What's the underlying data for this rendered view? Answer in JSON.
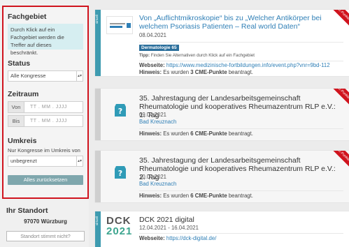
{
  "sidebar": {
    "fachgebiet": {
      "title": "Fachgebiet",
      "hint": "Durch Klick auf ein Fachgebiet werden die Treffer auf dieses beschränkt."
    },
    "status": {
      "title": "Status",
      "selected": "Alle Kongresse"
    },
    "zeitraum": {
      "title": "Zeitraum",
      "von_label": "Von",
      "bis_label": "Bis",
      "date_placeholder": "TT . MM . JJJJ"
    },
    "umkreis": {
      "title": "Umkreis",
      "desc": "Nur Kongresse im Umkreis von",
      "selected": "unbegrenzt"
    },
    "reset_label": "Alles zurücksetzen",
    "standort": {
      "title": "Ihr Standort",
      "value": "97070 Würzburg",
      "button": "Standort stimmt nicht?"
    }
  },
  "cards": [
    {
      "flag": "virtuell",
      "title": "Von „Auflichtmikroskopie“ bis zu „Welcher Antikörper bei welchem Psoriasis Patienten – Real world Daten“",
      "date": "08.04.2021",
      "badge": "Dermatologie 65",
      "tipp_label": "Tipp:",
      "tipp_text": "Finden Sie Alternativen durch Klick auf ein Fachgebiet",
      "link_label": "Webseite:",
      "link_url": "https://www.medizinische-fortbildungen.info/event.php?vnr=9bd-112",
      "note_label": "Hinweis:",
      "note_pre": "Es wurden",
      "note_points": "3 CME-Punkte",
      "note_post": "beantragt.",
      "corner": "CME-Punkte"
    },
    {
      "title": "35. Jahrestagung der Landesarbeitsgemeinschaft Rheumatologie und kooperatives Rheumazentrum RLP e.V.: 1. Tag",
      "date": "09.04.2021",
      "location": "Bad Kreuznach",
      "note_label": "Hinweis:",
      "note_pre": "Es wurden",
      "note_points": "6 CME-Punkte",
      "note_post": "beantragt.",
      "corner": "CME-Punkte"
    },
    {
      "title": "35. Jahrestagung der Landesarbeitsgemeinschaft Rheumatologie und kooperatives Rheumazentrum RLP e.V.: 2. Tag",
      "date": "10.04.2021",
      "location": "Bad Kreuznach",
      "note_label": "Hinweis:",
      "note_pre": "Es wurden",
      "note_points": "6 CME-Punkte",
      "note_post": "beantragt.",
      "corner": "CME-Punkte"
    },
    {
      "flag": "virtuell",
      "logo_top": "DCK",
      "logo_bottom": "2021",
      "title": "DCK 2021 digital",
      "date": "12.04.2021 - 16.04.2021",
      "link_label": "Webseite:",
      "link_url": "https://dck-digital.de/"
    }
  ],
  "colors": {
    "highlight_border": "#d0141e",
    "accent_teal": "#3e9bb0",
    "link_blue": "#2f7fb6",
    "reset_button": "#7fa7ad"
  }
}
